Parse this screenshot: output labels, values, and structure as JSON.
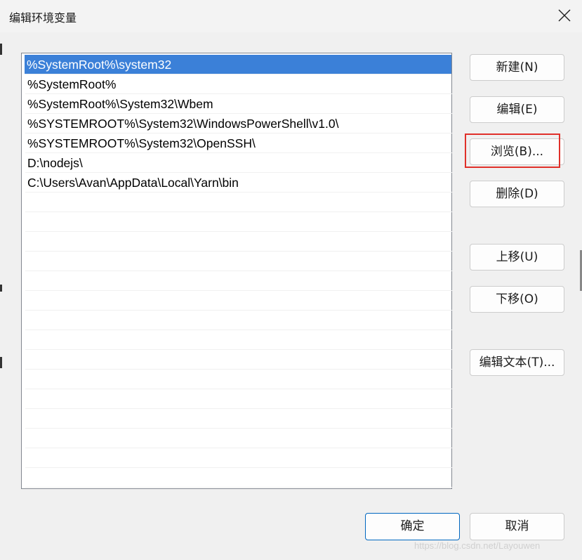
{
  "window": {
    "title": "编辑环境变量",
    "close_icon": "close-icon"
  },
  "paths": [
    "%SystemRoot%\\system32",
    "%SystemRoot%",
    "%SystemRoot%\\System32\\Wbem",
    "%SYSTEMROOT%\\System32\\WindowsPowerShell\\v1.0\\",
    "%SYSTEMROOT%\\System32\\OpenSSH\\",
    "D:\\nodejs\\",
    "C:\\Users\\Avan\\AppData\\Local\\Yarn\\bin"
  ],
  "selected_index": 0,
  "buttons": {
    "new": "新建(N)",
    "edit": "编辑(E)",
    "browse": "浏览(B)...",
    "delete": "删除(D)",
    "move_up": "上移(U)",
    "move_down": "下移(O)",
    "edit_text": "编辑文本(T)...",
    "ok": "确定",
    "cancel": "取消"
  },
  "annotation": {
    "highlighted_button": "browse",
    "color": "#e0302a"
  },
  "colors": {
    "selection": "#3b80d8",
    "primary_border": "#0067c0"
  },
  "watermark": "https://blog.csdn.net/Layouwen"
}
